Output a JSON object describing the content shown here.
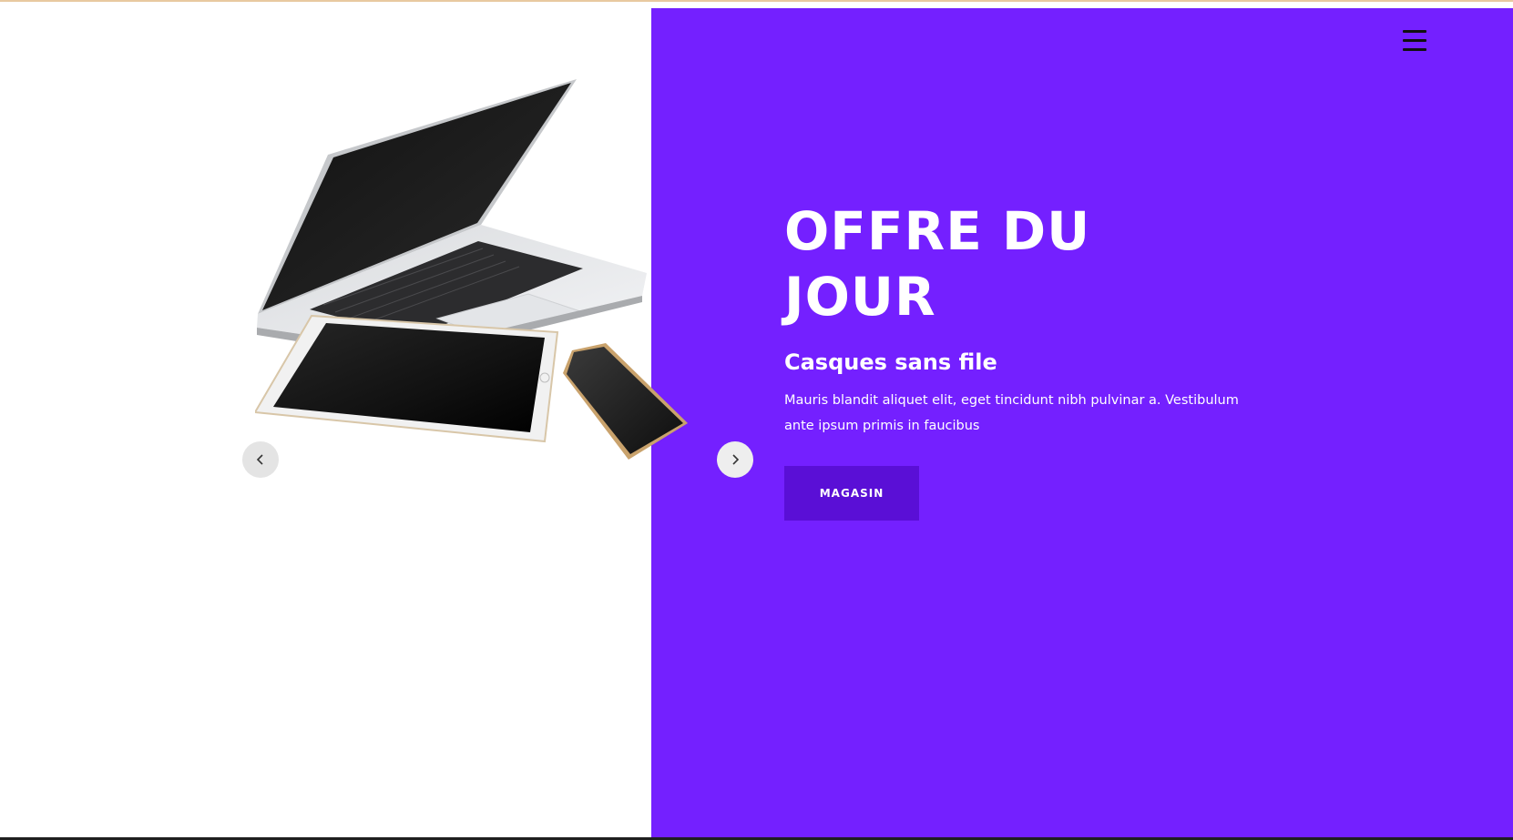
{
  "hero": {
    "title": "OFFRE DU JOUR",
    "subtitle": "Casques sans file",
    "description": "Mauris blandit aliquet elit, eget tincidunt nibh pulvinar a. Vestibulum ante ipsum primis in faucibus",
    "button_label": "MAGASIN"
  },
  "icons": {
    "menu": "hamburger-menu-icon",
    "prev": "chevron-left-icon",
    "next": "chevron-right-icon"
  },
  "colors": {
    "accent": "#7420ff",
    "button": "#5a0fd6",
    "text_light": "#ffffff"
  }
}
